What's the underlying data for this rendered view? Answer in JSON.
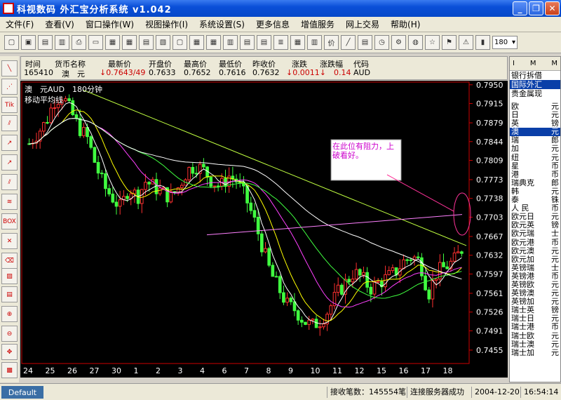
{
  "window": {
    "title": "科视数码 外汇宝分析系统 v1.042"
  },
  "menu": [
    "文件(F)",
    "查看(V)",
    "窗口操作(W)",
    "视图操作(I)",
    "系统设置(S)",
    "更多信息",
    "增值服务",
    "网上交易",
    "帮助(H)"
  ],
  "toolbar": {
    "zoom": "180"
  },
  "left_tools": [
    "Tik",
    "BOX"
  ],
  "quote": {
    "headers": [
      "时间",
      "货币名称",
      "最新价",
      "开盘价",
      "最高价",
      "最低价",
      "昨收价",
      "涨跌",
      "涨跌幅",
      "代码"
    ],
    "values": [
      "165410",
      "澳　元",
      "↓0.7643/49",
      "0.7633",
      "0.7652",
      "0.7616",
      "0.7632",
      "↓0.0011↓",
      "0.14",
      "AUD"
    ],
    "colors": {
      "up": "#cc0000",
      "normal": "#000000"
    }
  },
  "chart_data": {
    "type": "candlestick",
    "instrument_label": "澳　元AUD　180分钟",
    "indicator_label": "移动平均线",
    "y_ticks": [
      "0.7950",
      "0.7915",
      "0.7879",
      "0.7844",
      "0.7809",
      "0.7773",
      "0.7738",
      "0.7703",
      "0.7667",
      "0.7632",
      "0.7597",
      "0.7561",
      "0.7526",
      "0.7491",
      "0.7455"
    ],
    "ylim": [
      0.743,
      0.7955
    ],
    "x_labels": [
      "24",
      "25",
      "26",
      "27",
      "30",
      "1",
      "2",
      "3",
      "4",
      "6",
      "7",
      "8",
      "9",
      "10",
      "11",
      "12",
      "15",
      "16",
      "17",
      "18"
    ],
    "annotation": "在此位有阻力，上破看好。",
    "close_path": [
      0.784,
      0.786,
      0.788,
      0.792,
      0.793,
      0.79,
      0.787,
      0.785,
      0.78,
      0.776,
      0.774,
      0.772,
      0.776,
      0.774,
      0.777,
      0.776,
      0.775,
      0.774,
      0.776,
      0.779,
      0.78,
      0.779,
      0.777,
      0.776,
      0.778,
      0.777,
      0.774,
      0.77,
      0.765,
      0.76,
      0.757,
      0.754,
      0.753,
      0.751,
      0.75,
      0.751,
      0.753,
      0.756,
      0.758,
      0.76,
      0.759,
      0.757,
      0.758,
      0.759,
      0.76,
      0.762,
      0.763,
      0.762,
      0.756,
      0.76,
      0.761,
      0.762,
      0.7643
    ]
  },
  "right_panel": {
    "header": [
      "I",
      "M",
      "M"
    ],
    "tabs": [
      "银行拆借",
      "国际外汇",
      "贵金属现"
    ],
    "items": [
      [
        "欧",
        "元"
      ],
      [
        "日",
        "元"
      ],
      [
        "英",
        "镑"
      ],
      [
        "澳",
        "元"
      ],
      [
        "瑞",
        "郎"
      ],
      [
        "加",
        "元"
      ],
      [
        "纽",
        "元"
      ],
      [
        "星",
        "币"
      ],
      [
        "港",
        "币"
      ],
      [
        "瑞典克",
        "郎"
      ],
      [
        "韩",
        "元"
      ],
      [
        "泰",
        "铢"
      ],
      [
        "人 民",
        "币"
      ],
      [
        "欧元日",
        "元"
      ],
      [
        "欧元英",
        "镑"
      ],
      [
        "欧元瑞",
        "士"
      ],
      [
        "欧元港",
        "币"
      ],
      [
        "欧元澳",
        "元"
      ],
      [
        "欧元加",
        "元"
      ],
      [
        "英镑瑞",
        "士"
      ],
      [
        "英镑港",
        "币"
      ],
      [
        "英镑欧",
        "元"
      ],
      [
        "英镑澳",
        "元"
      ],
      [
        "英镑加",
        "元"
      ],
      [
        "瑞士英",
        "镑"
      ],
      [
        "瑞士日",
        "元"
      ],
      [
        "瑞士港",
        "币"
      ],
      [
        "瑞士欧",
        "元"
      ],
      [
        "瑞士澳",
        "元"
      ],
      [
        "瑞士加",
        "元"
      ]
    ]
  },
  "status": {
    "tab": "Default",
    "received": "接收笔数：145554笔",
    "connection": "连接服务器成功",
    "date": "2004-12-20",
    "time": "16:54:14"
  }
}
